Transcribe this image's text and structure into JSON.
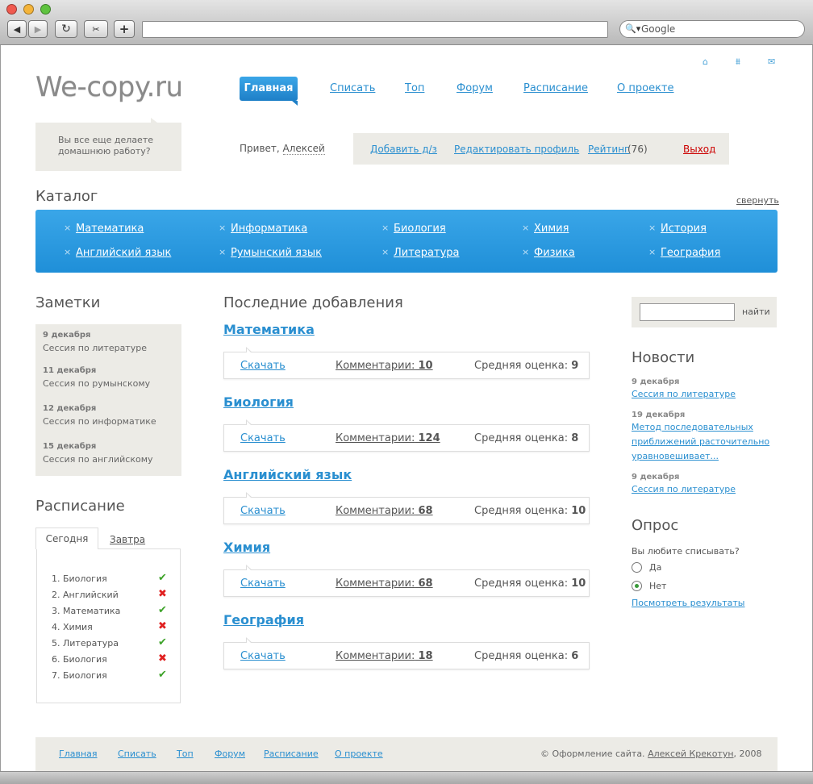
{
  "browser": {
    "search_placeholder": "Google",
    "back": "◀",
    "forward": "▶",
    "reload": "↻",
    "plus": "+"
  },
  "header": {
    "logo": "We-copy.ru",
    "tagline": "Вы все еще делаете домашнюю работу?",
    "nav": {
      "active": "Главная",
      "items": [
        "Списать",
        "Топ",
        "Форум",
        "Расписание",
        "О проекте"
      ]
    },
    "greeting_prefix": "Привет,",
    "user_name": "Алексей",
    "userbar": {
      "add": "Добавить д/з",
      "edit": "Редактировать профиль",
      "rating_label": "Рейтинг",
      "rating_value": "(76)",
      "logout": "Выход"
    }
  },
  "catalog": {
    "title": "Каталог",
    "collapse": "свернуть",
    "items": [
      "Математика",
      "Информатика",
      "Биология",
      "Химия",
      "История",
      "Английский язык",
      "Румынский язык",
      "Литература",
      "Физика",
      "География"
    ]
  },
  "notes": {
    "title": "Заметки",
    "items": [
      {
        "date": "9 декабря",
        "text": "Сессия по литературе"
      },
      {
        "date": "11 декабря",
        "text": "Сессия по румынскому"
      },
      {
        "date": "12 декабря",
        "text": "Сессия по информатике"
      },
      {
        "date": "15 декабря",
        "text": "Сессия по английскому"
      }
    ]
  },
  "schedule": {
    "title": "Расписание",
    "tab_today": "Сегодня",
    "tab_tomorrow": "Завтра",
    "items": [
      {
        "label": "1. Биология",
        "mark": "✔"
      },
      {
        "label": "2. Английский",
        "mark": "✖"
      },
      {
        "label": "3. Математика",
        "mark": "✔"
      },
      {
        "label": "4. Химия",
        "mark": "✖"
      },
      {
        "label": "5. Литература",
        "mark": "✔"
      },
      {
        "label": "6. Биология",
        "mark": "✖"
      },
      {
        "label": "7. Биология",
        "mark": "✔"
      }
    ],
    "colors": {
      "ok": "#3ea32a",
      "no": "#e02020"
    }
  },
  "recent": {
    "title": "Последние добавления",
    "download_label": "Скачать",
    "comments_label": "Комментарии:",
    "rating_label": "Средняя оценка:",
    "items": [
      {
        "subject": "Математика",
        "comments": "10",
        "rating": "9"
      },
      {
        "subject": "Биология",
        "comments": "124",
        "rating": "8"
      },
      {
        "subject": "Английский язык",
        "comments": "68",
        "rating": "10"
      },
      {
        "subject": "Химия",
        "comments": "68",
        "rating": "10"
      },
      {
        "subject": "География",
        "comments": "18",
        "rating": "6"
      }
    ]
  },
  "search": {
    "button": "найти"
  },
  "news": {
    "title": "Новости",
    "items": [
      {
        "date": "9 декабря",
        "text": "Сессия по литературе"
      },
      {
        "date": "19 декабря",
        "text": "Метод последовательных приближений расточительно уравновешивает..."
      },
      {
        "date": "9 декабря",
        "text": "Сессия по литературе"
      }
    ]
  },
  "poll": {
    "title": "Опрос",
    "question": "Вы любите списывать?",
    "options": [
      "Да",
      "Нет"
    ],
    "selected": "Нет",
    "results": "Посмотреть результаты"
  },
  "footer": {
    "links": [
      "Главная",
      "Списать",
      "Топ",
      "Форум",
      "Расписание",
      "О проекте"
    ],
    "copy_prefix": "© Оформление сайта.",
    "author": "Алексей Крекотун",
    "year": ", 2008"
  },
  "colors": {
    "accent": "#2a8fd0",
    "catalog_bg": "#2a9be0",
    "panel_bg": "#ecebe6",
    "logout": "#cc0000"
  }
}
